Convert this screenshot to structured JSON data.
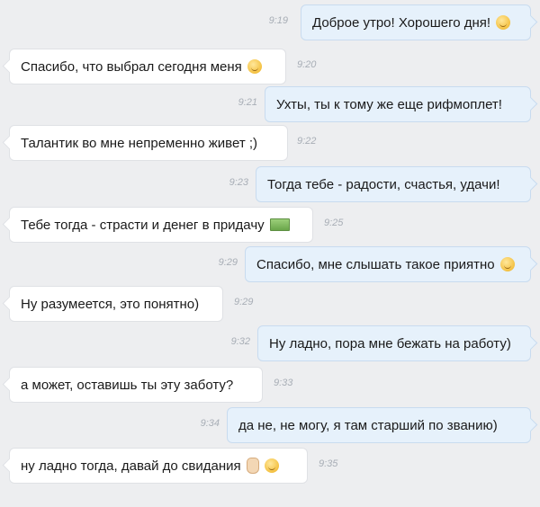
{
  "messages": [
    {
      "direction": "out",
      "text": "Доброе утро! Хорошего дня!",
      "time": "9:19",
      "icon": "wink-emoji-icon"
    },
    {
      "direction": "in",
      "text": "Спасибо, что выбрал сегодня меня",
      "time": "9:20",
      "icon": "wink-emoji-icon"
    },
    {
      "direction": "out",
      "text": "Ухты, ты к тому же еще рифмоплет!",
      "time": "9:21",
      "icon": ""
    },
    {
      "direction": "in",
      "text": "Талантик во мне непременно живет ;)",
      "time": "9:22",
      "icon": ""
    },
    {
      "direction": "out",
      "text": "Тогда тебе - радости, счастья, удачи!",
      "time": "9:23",
      "icon": ""
    },
    {
      "direction": "in",
      "text": "Тебе тогда - страсти и денег в придачу",
      "time": "9:25",
      "icon": "money-icon"
    },
    {
      "direction": "out",
      "text": "Спасибо, мне слышать такое приятно",
      "time": "9:29",
      "icon": "smile-emoji-icon"
    },
    {
      "direction": "in",
      "text": "Ну разумеется, это понятно)",
      "time": "9:29",
      "icon": ""
    },
    {
      "direction": "out",
      "text": "Ну ладно, пора мне бежать на работу)",
      "time": "9:32",
      "icon": ""
    },
    {
      "direction": "in",
      "text": "а может, оставишь ты эту заботу?",
      "time": "9:33",
      "icon": ""
    },
    {
      "direction": "out",
      "text": "да не, не могу, я там старший по званию)",
      "time": "9:34",
      "icon": ""
    },
    {
      "direction": "in",
      "text": "ну ладно тогда, давай до свидания",
      "time": "9:35",
      "icon": "wave-hand-icon"
    }
  ]
}
